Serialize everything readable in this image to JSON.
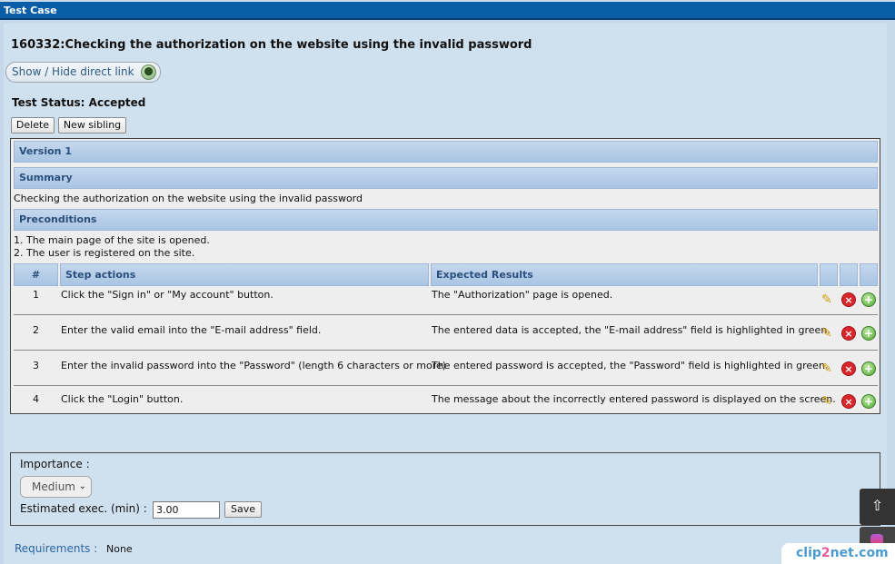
{
  "window": {
    "title": "Test Case"
  },
  "testcase": {
    "title": "160332:Checking the authorization on the website using the invalid password",
    "direct_link_label": "Show / Hide direct link",
    "status": "Test Status: Accepted",
    "buttons": {
      "delete": "Delete",
      "new_sibling": "New sibling"
    }
  },
  "version": {
    "label": "Version 1"
  },
  "summary": {
    "label": "Summary",
    "text": "Checking the authorization on the website using the invalid password"
  },
  "preconditions": {
    "label": "Preconditions",
    "lines": [
      "1. The main page of the site is opened.",
      "2. The user is registered on the site."
    ]
  },
  "steps": {
    "headers": {
      "num": "#",
      "actions": "Step actions",
      "expected": "Expected Results"
    },
    "rows": [
      {
        "num": "1",
        "action": "Click the \"Sign in\" or \"My account\" button.",
        "expected": "The \"Authorization\" page is opened."
      },
      {
        "num": "2",
        "action": "Enter the valid email into the \"E-mail address\" field.",
        "expected": "The entered data is accepted, the \"E-mail address\" field is highlighted in green."
      },
      {
        "num": "3",
        "action": "Enter the invalid password into the \"Password\" (length 6 characters or more)",
        "expected": "The entered password is accepted, the \"Password\" field is highlighted in green."
      },
      {
        "num": "4",
        "action": "Click the \"Login\" button.",
        "expected": "The message about the incorrectly entered password is displayed on the screen."
      }
    ]
  },
  "importance": {
    "label": "Importance :",
    "selected": "Medium",
    "est_label": "Estimated exec. (min) :",
    "est_value": "3.00",
    "save_label": "Save"
  },
  "requirements": {
    "label": "Requirements :",
    "value": "None"
  },
  "watermark": {
    "text_a": "clip",
    "text_b": "2",
    "text_c": "net.com"
  },
  "icons": {
    "edit": "pencil-icon",
    "delete": "delete-icon",
    "add": "add-icon",
    "scroll_top": "scroll-top-icon",
    "link": "link-icon"
  }
}
